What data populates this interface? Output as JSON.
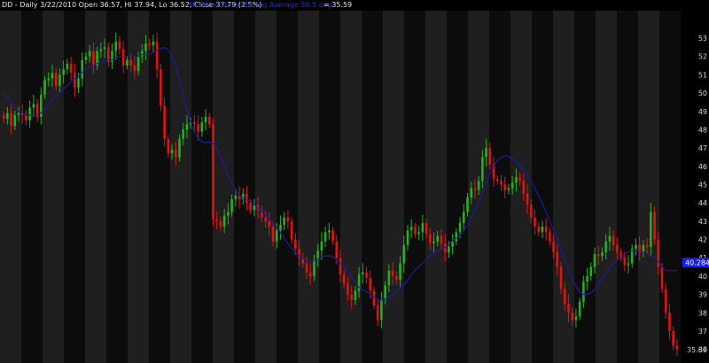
{
  "header": {
    "symbol_line": "DD - Daily 3/22/2010 Open 36.57, Hi 37.94, Lo 36.52, Close 37.79 (2.5%)",
    "indicator_line": "Modified Daily Moving Average 50.5 avg.",
    "indicator_value": "= 35.59"
  },
  "colors": {
    "background": "#000000",
    "band_light": "#1f1f1f",
    "band_dark": "#0c0c0c",
    "up": "#22b11c",
    "down": "#e01313",
    "ma": "#1c1ca0",
    "axis_text": "#d8d8d8",
    "tag_bg": "#1a1aff"
  },
  "chart_data": {
    "type": "line",
    "title": "DD - Daily 3/22/2010",
    "ylim": [
      35.5,
      54.5
    ],
    "y_ticks": [
      36,
      37,
      38,
      39,
      40,
      41,
      42,
      43,
      44,
      45,
      46,
      47,
      48,
      49,
      50,
      51,
      52,
      53
    ],
    "grid": false,
    "series": [
      {
        "kind": "close",
        "values": [
          48.6,
          48.9,
          48.2,
          48.8,
          48.9,
          48.8,
          48.5,
          49.2,
          49.4,
          48.7,
          49.9,
          50.7,
          50.8,
          51.1,
          50.4,
          51.0,
          51.3,
          51.6,
          51.1,
          50.3,
          50.8,
          51.8,
          52.0,
          52.3,
          51.5,
          52.3,
          52.4,
          52.5,
          51.7,
          52.3,
          52.8,
          52.4,
          51.5,
          51.8,
          51.5,
          51.2,
          52.0,
          52.3,
          52.7,
          52.6,
          52.8,
          51.3,
          49.3,
          47.5,
          46.7,
          46.9,
          46.5,
          47.5,
          48.0,
          48.3,
          48.4,
          48.3,
          47.9,
          48.4,
          48.7,
          48.3,
          43.1,
          43.0,
          42.7,
          43.3,
          43.5,
          44.2,
          44.4,
          44.2,
          44.5,
          44.0,
          43.6,
          43.9,
          43.6,
          43.2,
          43.0,
          42.7,
          41.9,
          42.5,
          42.8,
          43.2,
          43.0,
          42.0,
          41.5,
          41.0,
          40.7,
          40.2,
          40.0,
          40.9,
          41.4,
          41.9,
          42.4,
          42.5,
          41.9,
          41.0,
          40.1,
          39.6,
          39.0,
          38.7,
          39.2,
          40.1,
          40.2,
          39.9,
          39.2,
          38.4,
          37.6,
          38.7,
          39.5,
          40.3,
          40.0,
          39.8,
          40.7,
          41.7,
          42.5,
          42.7,
          42.3,
          42.4,
          42.9,
          42.3,
          41.8,
          41.9,
          42.2,
          41.8,
          41.3,
          41.6,
          41.9,
          42.4,
          42.9,
          43.5,
          44.3,
          44.8,
          44.7,
          45.2,
          46.5,
          47.0,
          46.1,
          45.3,
          45.2,
          45.0,
          44.7,
          44.8,
          45.1,
          45.4,
          45.2,
          44.5,
          43.9,
          43.2,
          42.7,
          42.4,
          42.7,
          42.4,
          41.9,
          41.3,
          40.5,
          39.3,
          38.5,
          38.0,
          37.6,
          37.8,
          38.6,
          39.7,
          40.0,
          40.5,
          41.2,
          41.1,
          41.3,
          41.9,
          42.2,
          41.7,
          41.3,
          41.0,
          40.6,
          40.7,
          41.5,
          41.7,
          41.3,
          41.7,
          41.6,
          43.5,
          42.0,
          40.5,
          39.3,
          38.0,
          37.0,
          36.2,
          36.0
        ]
      },
      {
        "kind": "moving_average",
        "name": "Modified Daily Moving Average 50.5 avg.",
        "values": [
          50.0,
          49.8,
          49.5,
          49.2,
          49.0,
          48.9,
          48.8,
          48.8,
          48.8,
          48.8,
          48.9,
          49.1,
          49.3,
          49.6,
          49.8,
          50.0,
          50.2,
          50.4,
          50.6,
          50.8,
          50.9,
          51.1,
          51.3,
          51.4,
          51.5,
          51.6,
          51.7,
          51.7,
          51.8,
          51.8,
          51.9,
          52.0,
          52.0,
          52.0,
          52.0,
          52.0,
          52.0,
          52.1,
          52.1,
          52.1,
          52.2,
          52.3,
          52.4,
          52.5,
          52.4,
          52.1,
          51.6,
          50.9,
          50.1,
          49.3,
          48.6,
          48.0,
          47.6,
          47.4,
          47.3,
          47.3,
          47.3,
          47.1,
          46.7,
          46.2,
          45.7,
          45.2,
          44.8,
          44.5,
          44.3,
          44.2,
          44.1,
          44.0,
          43.8,
          43.6,
          43.4,
          43.2,
          43.0,
          42.8,
          42.5,
          42.2,
          41.9,
          41.6,
          41.4,
          41.2,
          41.0,
          40.9,
          40.8,
          40.8,
          40.9,
          41.0,
          41.1,
          41.1,
          41.1,
          41.0,
          40.8,
          40.6,
          40.4,
          40.1,
          39.8,
          39.5,
          39.3,
          39.2,
          39.1,
          38.9,
          38.8,
          38.7,
          38.7,
          38.8,
          38.9,
          39.0,
          39.2,
          39.4,
          39.6,
          39.9,
          40.2,
          40.4,
          40.6,
          40.8,
          41.0,
          41.2,
          41.3,
          41.4,
          41.5,
          41.6,
          41.8,
          42.0,
          42.1,
          42.3,
          42.6,
          42.9,
          43.3,
          43.7,
          44.2,
          44.7,
          45.2,
          45.7,
          46.1,
          46.4,
          46.5,
          46.6,
          46.5,
          46.4,
          46.2,
          46.0,
          45.7,
          45.4,
          45.1,
          44.7,
          44.3,
          43.9,
          43.4,
          42.9,
          42.4,
          41.9,
          41.4,
          40.8,
          40.3,
          39.8,
          39.4,
          39.1,
          39.0,
          39.0,
          39.1,
          39.3,
          39.6,
          39.9,
          40.2,
          40.5,
          40.7,
          40.9,
          41.1,
          41.2,
          41.3,
          41.4,
          41.4,
          41.4,
          41.3,
          41.2,
          41.1,
          41.0,
          40.8,
          40.5,
          40.3,
          40.3,
          40.3,
          40.3
        ]
      }
    ],
    "last_price_label": "40.2844",
    "last_value_label": "35.69"
  }
}
